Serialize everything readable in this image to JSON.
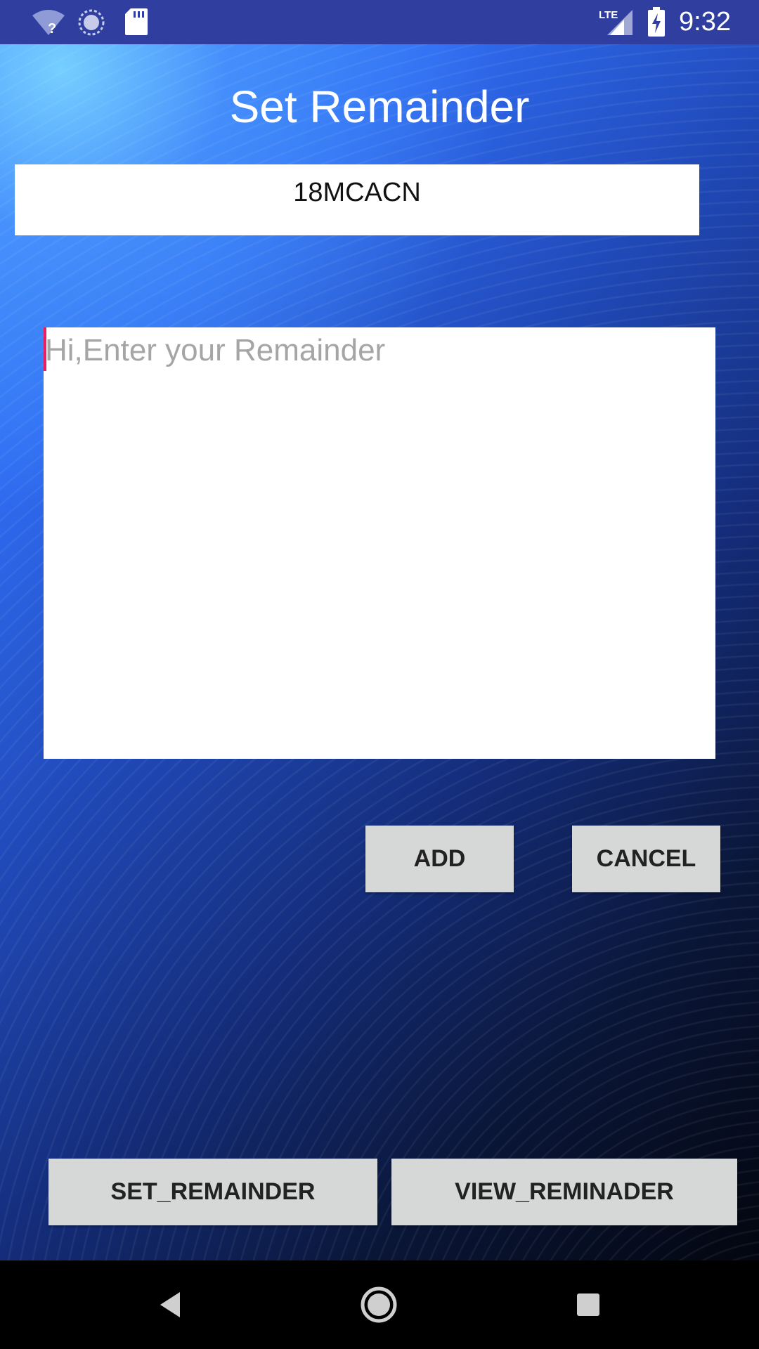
{
  "status_bar": {
    "time": "9:32",
    "network_label": "LTE",
    "icons": [
      "wifi-question-icon",
      "sync-icon",
      "sd-card-icon",
      "lte-signal-icon",
      "battery-charging-icon"
    ],
    "background": "#303f9f"
  },
  "screen": {
    "title": "Set Remainder",
    "code_value": "18MCACN",
    "remainder_input": {
      "placeholder": "Hi,Enter your Remainder",
      "value": ""
    },
    "buttons": {
      "add": "ADD",
      "cancel": "CANCEL",
      "set_remainder": "SET_REMAINDER",
      "view_remainder": "VIEW_REMINADER"
    }
  },
  "nav_bar": {
    "icons": [
      "back-icon",
      "home-icon",
      "recents-icon"
    ]
  },
  "colors": {
    "button_bg": "#d6d7d7",
    "cursor": "#e91e63",
    "text_placeholder": "#a5a5a5"
  }
}
